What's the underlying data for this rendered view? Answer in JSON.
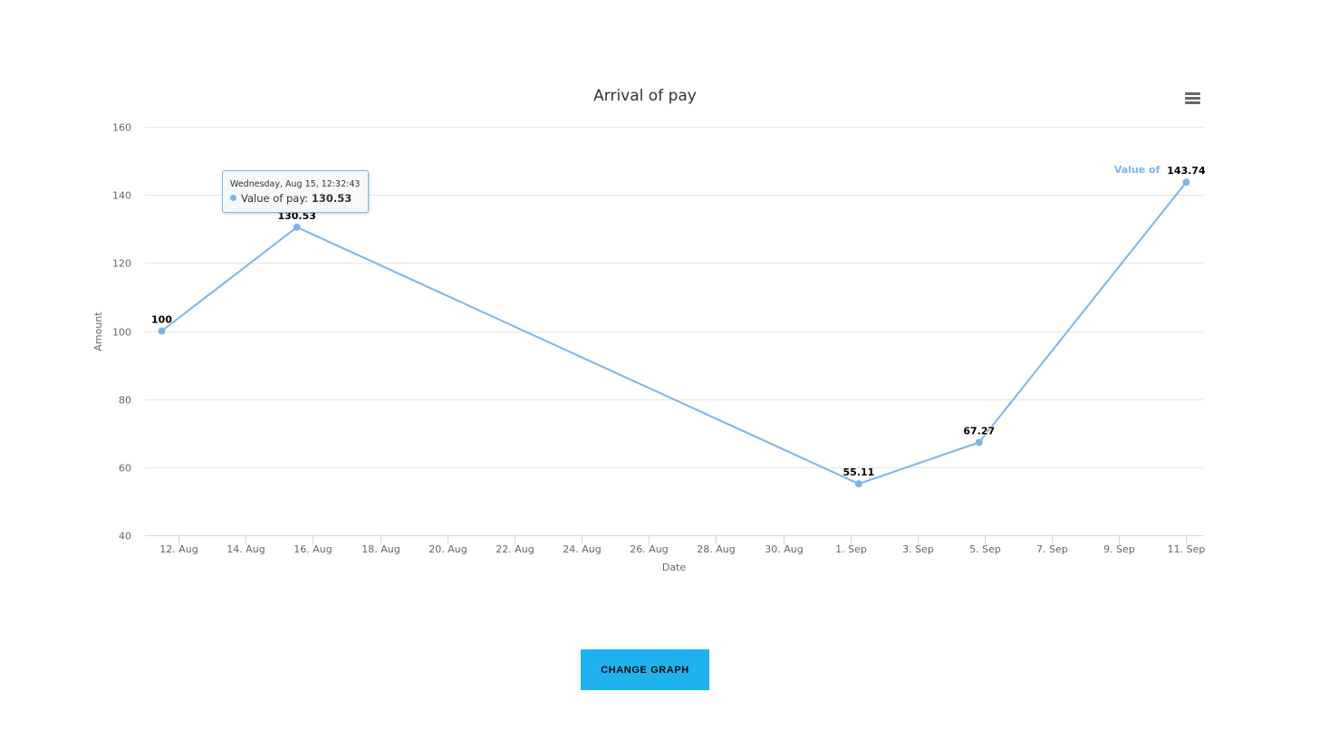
{
  "chart_data": {
    "type": "line",
    "title": "Arrival of pay",
    "xlabel": "Date",
    "ylabel": "Amount",
    "ylim": [
      40,
      160
    ],
    "yticks": [
      40,
      60,
      80,
      100,
      120,
      140,
      160
    ],
    "xlim": [
      "2018-08-11",
      "2018-09-11"
    ],
    "xtick_labels": [
      "12. Aug",
      "14. Aug",
      "16. Aug",
      "18. Aug",
      "20. Aug",
      "22. Aug",
      "24. Aug",
      "26. Aug",
      "28. Aug",
      "30. Aug",
      "1. Sep",
      "3. Sep",
      "5. Sep",
      "7. Sep",
      "9. Sep",
      "11. Sep"
    ],
    "xtick_dates": [
      "2018-08-12",
      "2018-08-14",
      "2018-08-16",
      "2018-08-18",
      "2018-08-20",
      "2018-08-22",
      "2018-08-24",
      "2018-08-26",
      "2018-08-28",
      "2018-08-30",
      "2018-09-01",
      "2018-09-03",
      "2018-09-05",
      "2018-09-07",
      "2018-09-09",
      "2018-09-11"
    ],
    "grid": true,
    "series": [
      {
        "name": "Value of pay",
        "color": "#7cb5ec",
        "x": [
          "2018-08-11T12:00:00",
          "2018-08-15T12:32:43",
          "2018-09-01T06:00:00",
          "2018-09-04T20:00:00",
          "2018-09-11T00:00:00"
        ],
        "values": [
          100,
          130.53,
          55.11,
          67.27,
          143.74
        ],
        "data_labels": [
          "100",
          "130.53",
          "55.11",
          "67.27",
          "143.74"
        ],
        "end_label": "Value of"
      }
    ]
  },
  "tooltip": {
    "date": "Wednesday, Aug 15, 12:32:43",
    "series_label": "Value of pay: ",
    "value": "130.53"
  },
  "menu": {
    "icon": "hamburger-menu-icon"
  },
  "button": {
    "label": "CHANGE GRAPH",
    "color": "#1eb2ef"
  }
}
